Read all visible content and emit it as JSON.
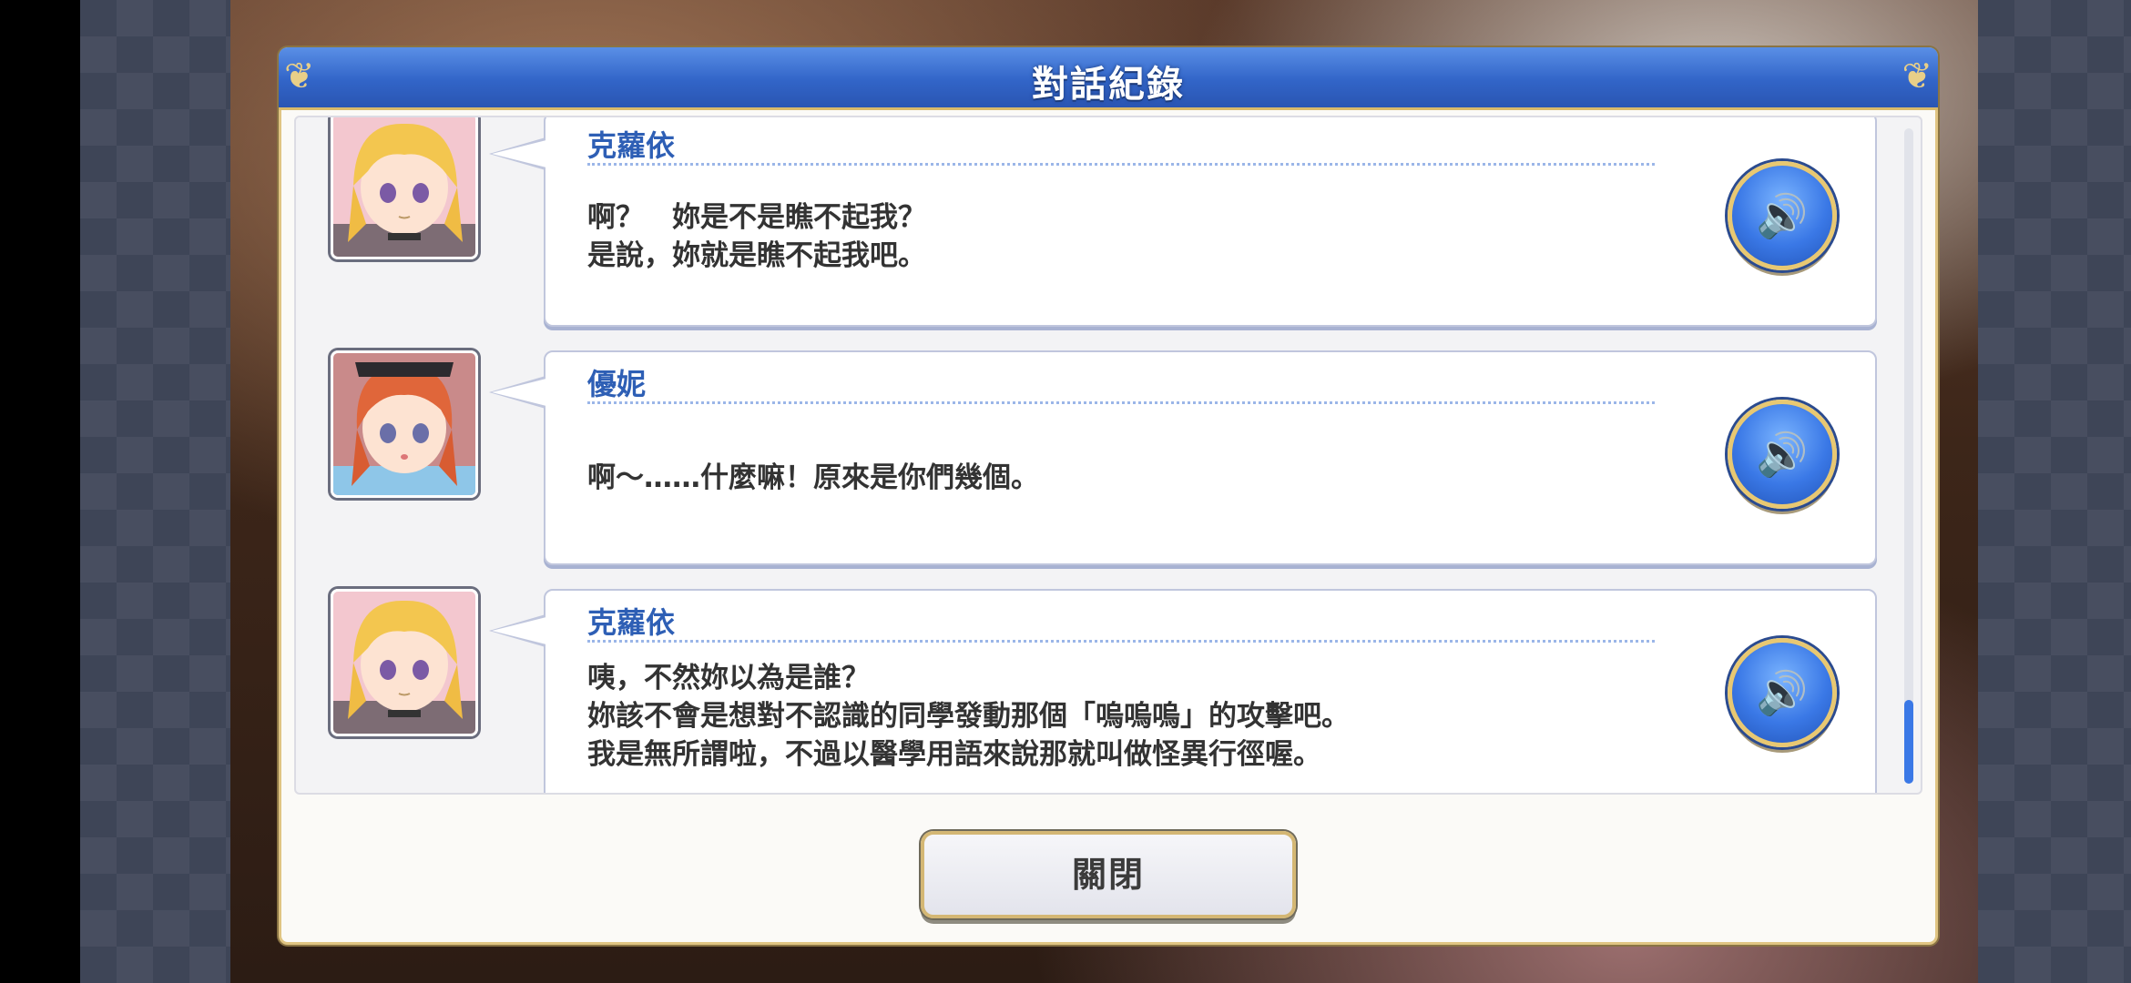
{
  "dialog": {
    "title": "對話紀錄",
    "close_label": "關閉"
  },
  "entries": [
    {
      "speaker": "克蘿依",
      "lines": [
        "啊？　妳是不是瞧不起我？",
        "是說，妳就是瞧不起我吧。"
      ],
      "voice_icon": "speaker-volume-icon"
    },
    {
      "speaker": "優妮",
      "lines": [
        "啊～……什麼嘛！原來是你們幾個。"
      ],
      "voice_icon": "speaker-volume-icon"
    },
    {
      "speaker": "克蘿依",
      "lines": [
        "咦，不然妳以為是誰？",
        "妳該不會是想對不認識的同學發動那個「嗚嗚嗚」的攻擊吧。",
        "我是無所謂啦，不過以醫學用語來說那就叫做怪異行徑喔。"
      ],
      "voice_icon": "speaker-volume-icon"
    }
  ],
  "colors": {
    "title_bar": "#3265c8",
    "speaker_name": "#2e5fb5",
    "gold_border": "#e0c583"
  }
}
